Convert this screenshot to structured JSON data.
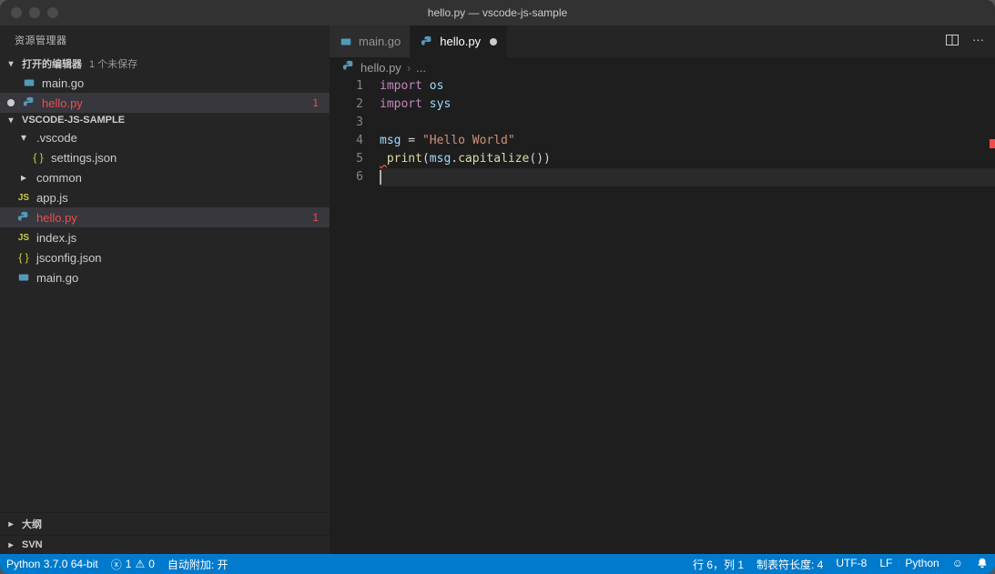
{
  "window": {
    "title": "hello.py — vscode-js-sample"
  },
  "sidebar": {
    "title": "资源管理器",
    "openEditors": {
      "label": "打开的编辑器",
      "badge": "1 个未保存",
      "items": [
        {
          "icon": "go",
          "name": "main.go",
          "modified": false,
          "error": false
        },
        {
          "icon": "py",
          "name": "hello.py",
          "modified": true,
          "error": true,
          "problems": "1"
        }
      ]
    },
    "project": {
      "label": "VSCODE-JS-SAMPLE",
      "tree": [
        {
          "type": "folder-open",
          "name": ".vscode",
          "depth": 1
        },
        {
          "type": "json",
          "name": "settings.json",
          "depth": 2
        },
        {
          "type": "folder",
          "name": "common",
          "depth": 1
        },
        {
          "type": "js",
          "name": "app.js",
          "depth": 1
        },
        {
          "type": "py",
          "name": "hello.py",
          "depth": 1,
          "active": true,
          "error": true,
          "problems": "1"
        },
        {
          "type": "js",
          "name": "index.js",
          "depth": 1
        },
        {
          "type": "json",
          "name": "jsconfig.json",
          "depth": 1
        },
        {
          "type": "go",
          "name": "main.go",
          "depth": 1
        }
      ]
    },
    "outline": "大纲",
    "svn": "SVN"
  },
  "tabs": [
    {
      "icon": "go",
      "label": "main.go",
      "active": false,
      "modified": false
    },
    {
      "icon": "py",
      "label": "hello.py",
      "active": true,
      "modified": true
    }
  ],
  "breadcrumb": {
    "file": "hello.py",
    "tail": "..."
  },
  "code": {
    "lines": [
      [
        {
          "t": "import ",
          "c": "keyword"
        },
        {
          "t": "os",
          "c": "module"
        }
      ],
      [
        {
          "t": "import ",
          "c": "keyword"
        },
        {
          "t": "sys",
          "c": "module"
        }
      ],
      [],
      [
        {
          "t": "msg",
          "c": "var"
        },
        {
          "t": " = ",
          "c": "punct"
        },
        {
          "t": "\"Hello World\"",
          "c": "string"
        }
      ],
      [
        {
          "t": " ",
          "c": "punct",
          "squiggle": true
        },
        {
          "t": "print",
          "c": "func"
        },
        {
          "t": "(",
          "c": "punct"
        },
        {
          "t": "msg",
          "c": "var"
        },
        {
          "t": ".",
          "c": "punct"
        },
        {
          "t": "capitalize",
          "c": "func"
        },
        {
          "t": "())",
          "c": "punct"
        }
      ],
      []
    ],
    "currentLineIndex": 5
  },
  "statusbar": {
    "python": "Python 3.7.0 64-bit",
    "errors": "1",
    "warnings": "0",
    "autoAttach": "自动附加: 开",
    "position": "行 6，列 1",
    "tabSize": "制表符长度: 4",
    "encoding": "UTF-8",
    "eol": "LF",
    "language": "Python"
  }
}
